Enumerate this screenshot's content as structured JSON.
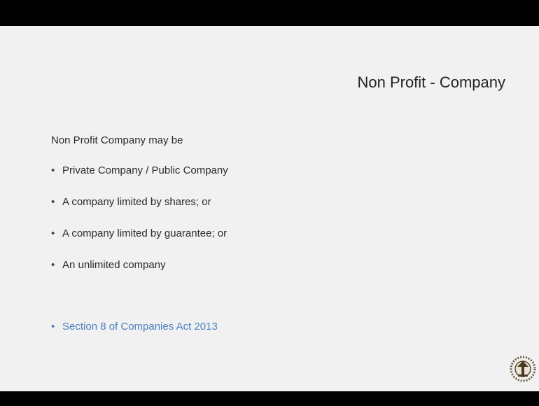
{
  "slide": {
    "title": "Non Profit - Company",
    "intro": "Non Profit Company may be",
    "bullet_marker": "•",
    "items": [
      "Private Company / Public Company",
      "A company  limited by shares; or",
      "A company  limited by guarantee; or",
      "An unlimited company"
    ],
    "highlight": "Section 8 of Companies Act 2013"
  },
  "colors": {
    "background": "#f1f1f1",
    "text": "#2a2a2a",
    "highlight": "#4a7fc0",
    "letterbox": "#000000"
  },
  "icons": {
    "corner_logo": "institute-emblem-icon"
  }
}
